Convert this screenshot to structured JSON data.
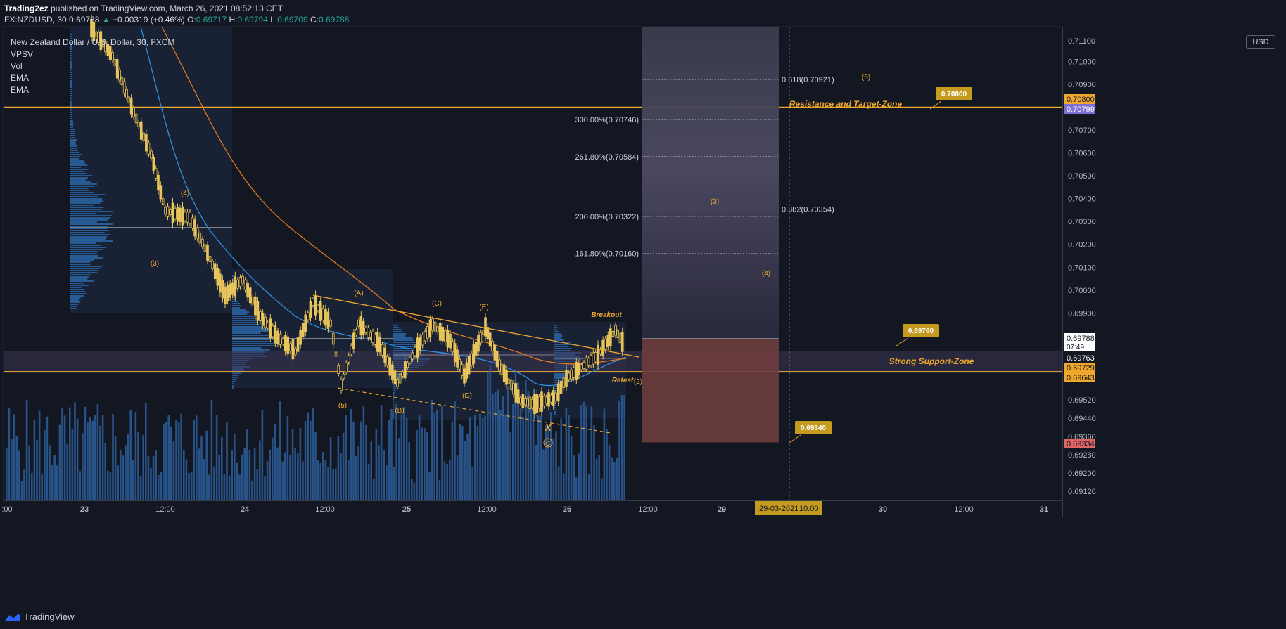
{
  "header": {
    "author": "Trading2ez",
    "published_text": " published on TradingView.com, March 26, 2021 08:52:13 CET",
    "symbol": "FX:NZDUSD, 30",
    "last": "0.69788",
    "change": "+0.00319 (+0.46%)",
    "o_label": "O:",
    "o": "0.69717",
    "h_label": "H:",
    "h": "0.69794",
    "l_label": "L:",
    "l": "0.69709",
    "c_label": "C:",
    "c": "0.69788"
  },
  "legend": [
    "New Zealand Dollar / U.S. Dollar, 30, FXCM",
    "VPSV",
    "Vol",
    "EMA",
    "EMA"
  ],
  "currency_button": "USD",
  "footer": {
    "brand": "TradingView",
    "logo_icon": "tradingview-logo-icon"
  },
  "colors": {
    "bg": "#131722",
    "accent": "#f0a82c",
    "up": "#26a69a",
    "volume": "#2e5f9e",
    "ema_fast": "#2f8fde",
    "ema_slow": "#e07b1e",
    "target_box": "#7e80a3",
    "stop_box": "#8b3a3a"
  },
  "chart_data": {
    "type": "candlestick",
    "title": "New Zealand Dollar / U.S. Dollar, 30, FXCM",
    "ylim": [
      0.6909,
      0.7117
    ],
    "x_ticks": [
      ":00",
      "23",
      "12:00",
      "24",
      "12:00",
      "25",
      "12:00",
      "26",
      "12:00",
      "29",
      "30",
      "12:00",
      "31"
    ],
    "y_ticks": [
      "0.71000",
      "0.70900",
      "0.70800",
      "0.70700",
      "0.70600",
      "0.70500",
      "0.70400",
      "0.70300",
      "0.70200",
      "0.70100",
      "0.70000",
      "0.69900",
      "0.69520",
      "0.69440",
      "0.69360",
      "0.69280",
      "0.69200",
      "0.69120"
    ],
    "y_partial_tick": "0.71100",
    "price_tags": [
      {
        "label": "0.70800",
        "type": "level"
      },
      {
        "label": "0.70799",
        "type": "line"
      },
      {
        "label": "0.69788",
        "sub": "07:49",
        "type": "last"
      },
      {
        "label": "0.69763",
        "type": "ema"
      },
      {
        "label": "0.69729",
        "type": "level"
      },
      {
        "label": "0.69643",
        "type": "level"
      },
      {
        "label": "0.69334",
        "type": "stop"
      }
    ],
    "cursor_date": "29-03-2021",
    "cursor_time": "10:00",
    "fib_extension_labels": [
      {
        "label": "300.00%(0.70746)"
      },
      {
        "label": "261.80%(0.70584)"
      },
      {
        "label": "200.00%(0.70322)"
      },
      {
        "label": "161.80%(0.70160)"
      }
    ],
    "fib_retracement_labels": [
      {
        "label": "0.618(0.70921)"
      },
      {
        "label": "0.382(0.70354)"
      }
    ],
    "annotations": [
      {
        "text": "Resistance and Target-Zone"
      },
      {
        "text": "Strong Support-Zone"
      },
      {
        "text": "Breakout"
      },
      {
        "text": "Retest"
      },
      {
        "text": "X"
      },
      {
        "text": "(5)"
      },
      {
        "text": "(3)"
      },
      {
        "text": "(4)"
      },
      {
        "text": "(3)"
      },
      {
        "text": "(4)"
      },
      {
        "text": "(A)"
      },
      {
        "text": "(C)"
      },
      {
        "text": "(E)"
      },
      {
        "text": "(5)"
      },
      {
        "text": "(B)"
      },
      {
        "text": "(D)"
      },
      {
        "text": "(2)"
      }
    ],
    "callouts": [
      {
        "text": "0.70800"
      },
      {
        "text": "0.69760"
      },
      {
        "text": "0.69340"
      }
    ],
    "resistance_level": 0.708,
    "support_zone": [
      0.69643,
      0.69729
    ],
    "target_level": 0.708,
    "stop_level": 0.69334,
    "entry_level": 0.69788
  }
}
